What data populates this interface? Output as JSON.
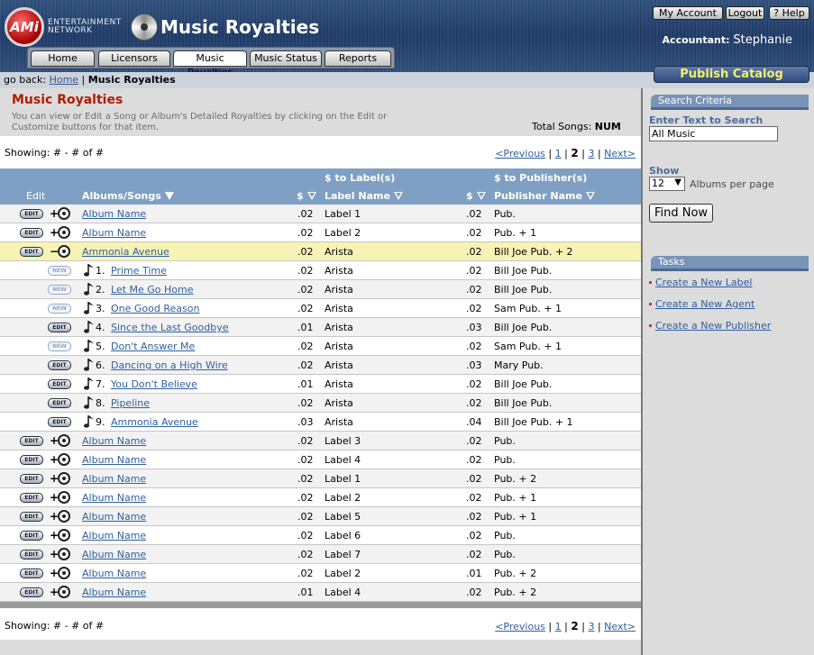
{
  "header": {
    "logo_text": "AMi",
    "brand_line1": "ENTERTAINMENT",
    "brand_line2": "NETWORK",
    "app_title": "Music Royalties",
    "utility": {
      "account": "My Account",
      "logout": "Logout",
      "help": "? Help"
    },
    "accountant_label": "Accountant:",
    "accountant_name": "Stephanie",
    "tabs": [
      "Home",
      "Licensors",
      "Music Royalties",
      "Music Status",
      "Reports"
    ],
    "active_tab": "Music Royalties",
    "publish_button": "Publish Catalog"
  },
  "breadcrumb": {
    "prefix": "go back:",
    "home": "Home",
    "separator": "|",
    "current": "Music Royalties"
  },
  "main": {
    "title": "Music Royalties",
    "description": "You can view or Edit a Song or Album's Detailed Royalties by clicking on the Edit or Customize buttons for that item.",
    "total_label": "Total Songs:",
    "total_value": "NUM",
    "showing": "Showing: # - # of #",
    "pager": {
      "prev": "<Previous",
      "p1": "1",
      "p2": "2",
      "p3": "3",
      "next": "Next>",
      "sep": "|"
    },
    "columns": {
      "edit": "Edit",
      "albums": "Albums/Songs",
      "label_group": "$ to Label(s)",
      "publisher_group": "$ to Publisher(s)",
      "dollar": "$",
      "label_name": "Label Name",
      "publisher_name": "Publisher Name"
    },
    "rows": [
      {
        "btn": "EDIT",
        "exp": "+",
        "name": "Album Name",
        "lab_amt": ".02",
        "label": "Label 1",
        "pub_amt": ".02",
        "pub": "Pub."
      },
      {
        "btn": "EDIT",
        "exp": "+",
        "name": "Album Name",
        "lab_amt": ".02",
        "label": "Label 2",
        "pub_amt": ".02",
        "pub": "Pub. + 1"
      },
      {
        "btn": "EDIT",
        "exp": "−",
        "name": "Ammonia Avenue",
        "lab_amt": ".02",
        "label": "Arista",
        "pub_amt": ".02",
        "pub": "Bill Joe Pub. + 2",
        "hl": true
      },
      {
        "btn": "NEW",
        "num": "1.",
        "name": "Prime Time",
        "lab_amt": ".02",
        "label": "Arista",
        "pub_amt": ".02",
        "pub": "Bill Joe Pub."
      },
      {
        "btn": "NEW",
        "num": "2.",
        "name": "Let Me Go Home",
        "lab_amt": ".02",
        "label": "Arista",
        "pub_amt": ".02",
        "pub": "Bill Joe Pub."
      },
      {
        "btn": "NEW",
        "num": "3.",
        "name": "One Good Reason",
        "lab_amt": ".02",
        "label": "Arista",
        "pub_amt": ".02",
        "pub": "Sam Pub. + 1"
      },
      {
        "btn": "EDIT",
        "num": "4.",
        "name": "Since the Last Goodbye",
        "lab_amt": ".01",
        "label": "Arista",
        "pub_amt": ".03",
        "pub": "Bill Joe Pub."
      },
      {
        "btn": "NEW",
        "num": "5.",
        "name": "Don't Answer Me",
        "lab_amt": ".02",
        "label": "Arista",
        "pub_amt": ".02",
        "pub": "Sam Pub. + 1"
      },
      {
        "btn": "EDIT",
        "num": "6.",
        "name": "Dancing on a High Wire",
        "lab_amt": ".02",
        "label": "Arista",
        "pub_amt": ".03",
        "pub": "Mary Pub."
      },
      {
        "btn": "EDIT",
        "num": "7.",
        "name": "You Don't Believe",
        "lab_amt": ".01",
        "label": "Arista",
        "pub_amt": ".02",
        "pub": "Bill Joe Pub."
      },
      {
        "btn": "EDIT",
        "num": "8.",
        "name": "Pipeline",
        "lab_amt": ".02",
        "label": "Arista",
        "pub_amt": ".02",
        "pub": "Bill Joe Pub."
      },
      {
        "btn": "EDIT",
        "num": "9.",
        "name": "Ammonia Avenue",
        "lab_amt": ".03",
        "label": "Arista",
        "pub_amt": ".04",
        "pub": "Bill Joe Pub. + 1"
      },
      {
        "btn": "EDIT",
        "exp": "+",
        "name": "Album Name",
        "lab_amt": ".02",
        "label": "Label 3",
        "pub_amt": ".02",
        "pub": "Pub."
      },
      {
        "btn": "EDIT",
        "exp": "+",
        "name": "Album Name",
        "lab_amt": ".02",
        "label": "Label 4",
        "pub_amt": ".02",
        "pub": "Pub."
      },
      {
        "btn": "EDIT",
        "exp": "+",
        "name": "Album Name",
        "lab_amt": ".02",
        "label": "Label 1",
        "pub_amt": ".02",
        "pub": "Pub. + 2"
      },
      {
        "btn": "EDIT",
        "exp": "+",
        "name": "Album Name",
        "lab_amt": ".02",
        "label": "Label 2",
        "pub_amt": ".02",
        "pub": "Pub. + 1"
      },
      {
        "btn": "EDIT",
        "exp": "+",
        "name": "Album Name",
        "lab_amt": ".02",
        "label": "Label 5",
        "pub_amt": ".02",
        "pub": "Pub. + 1"
      },
      {
        "btn": "EDIT",
        "exp": "+",
        "name": "Album Name",
        "lab_amt": ".02",
        "label": "Label 6",
        "pub_amt": ".02",
        "pub": "Pub."
      },
      {
        "btn": "EDIT",
        "exp": "+",
        "name": "Album Name",
        "lab_amt": ".02",
        "label": "Label 7",
        "pub_amt": ".02",
        "pub": "Pub."
      },
      {
        "btn": "EDIT",
        "exp": "+",
        "name": "Album Name",
        "lab_amt": ".02",
        "label": "Label 2",
        "pub_amt": ".01",
        "pub": "Pub. + 2"
      },
      {
        "btn": "EDIT",
        "exp": "+",
        "name": "Album Name",
        "lab_amt": ".01",
        "label": "Label 4",
        "pub_amt": ".02",
        "pub": "Pub. + 2"
      }
    ]
  },
  "sidebar": {
    "search_header": "Search Criteria",
    "search_label": "Enter Text to Search",
    "search_value": "All Music",
    "show_label": "Show",
    "show_value": "12",
    "per_page_label": "Albums per page",
    "find_button": "Find Now",
    "tasks_header": "Tasks",
    "tasks": [
      "Create a New Label",
      "Create a New Agent",
      "Create a New Publisher"
    ]
  },
  "colors": {
    "header_bg": "#1e3a66",
    "title_red": "#b31b00",
    "table_head": "#7fa0c2",
    "link": "#2f5f9e",
    "highlight_row": "#f7f3b4",
    "publish_text": "#f3f06a"
  },
  "icons": [
    "cd-icon",
    "disc-icon",
    "music-note-icon",
    "sort-arrow-icon"
  ]
}
